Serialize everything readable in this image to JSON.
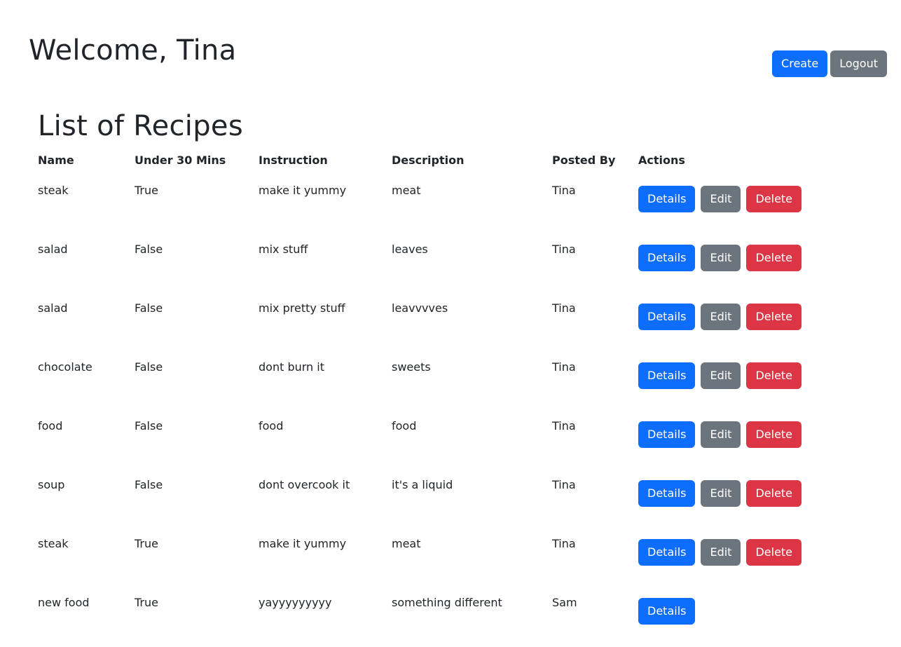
{
  "header": {
    "welcome": "Welcome, Tina",
    "create_label": "Create",
    "logout_label": "Logout"
  },
  "list_title": "List of Recipes",
  "table": {
    "columns": [
      "Name",
      "Under 30 Mins",
      "Instruction",
      "Description",
      "Posted By",
      "Actions"
    ],
    "action_labels": {
      "details": "Details",
      "edit": "Edit",
      "delete": "Delete"
    },
    "rows": [
      {
        "name": "steak",
        "under30": "True",
        "instruction": "make it yummy",
        "description": "meat",
        "posted_by": "Tina",
        "owned": true
      },
      {
        "name": "salad",
        "under30": "False",
        "instruction": "mix stuff",
        "description": "leaves",
        "posted_by": "Tina",
        "owned": true
      },
      {
        "name": "salad",
        "under30": "False",
        "instruction": "mix pretty stuff",
        "description": "leavvvves",
        "posted_by": "Tina",
        "owned": true
      },
      {
        "name": "chocolate",
        "under30": "False",
        "instruction": "dont burn it",
        "description": "sweets",
        "posted_by": "Tina",
        "owned": true
      },
      {
        "name": "food",
        "under30": "False",
        "instruction": "food",
        "description": "food",
        "posted_by": "Tina",
        "owned": true
      },
      {
        "name": "soup",
        "under30": "False",
        "instruction": "dont overcook it",
        "description": "it's a liquid",
        "posted_by": "Tina",
        "owned": true
      },
      {
        "name": "steak",
        "under30": "True",
        "instruction": "make it yummy",
        "description": "meat",
        "posted_by": "Tina",
        "owned": true
      },
      {
        "name": "new food",
        "under30": "True",
        "instruction": "yayyyyyyyyy",
        "description": "something different",
        "posted_by": "Sam",
        "owned": false
      }
    ]
  },
  "colors": {
    "primary": "#0d6efd",
    "secondary": "#6c757d",
    "danger": "#dc3545",
    "text": "#212529"
  }
}
